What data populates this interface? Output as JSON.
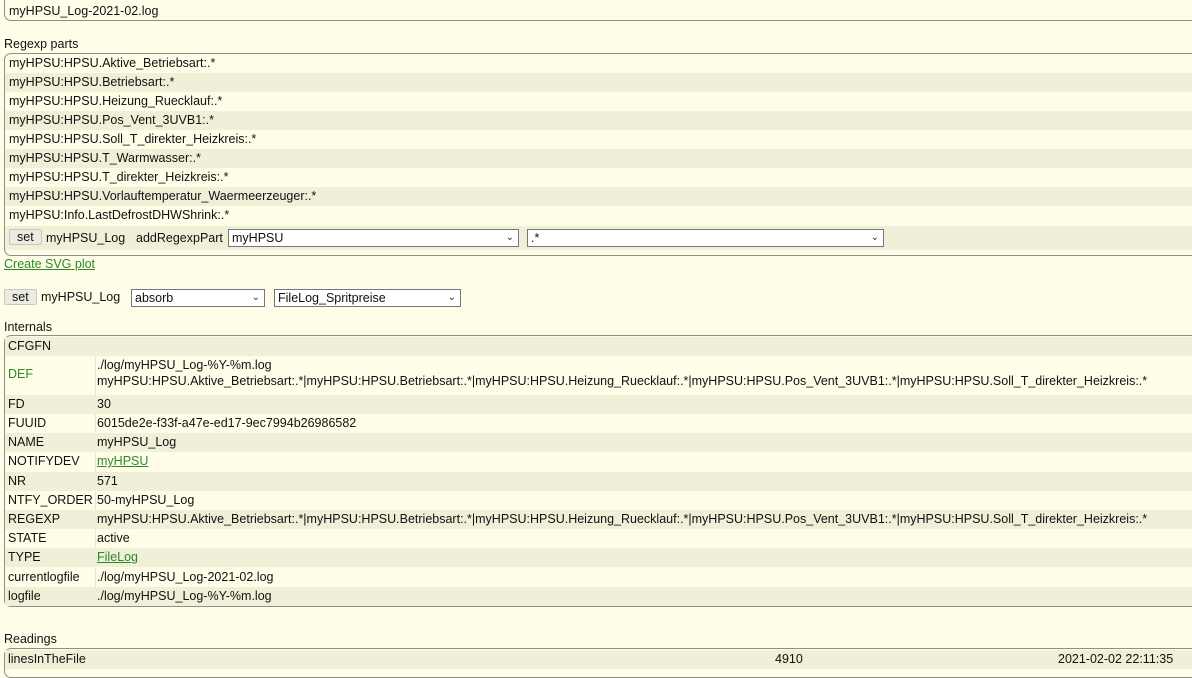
{
  "file_title": "myHPSU_Log-2021-02.log",
  "regexp_section": {
    "title": "Regexp parts",
    "parts": [
      "myHPSU:HPSU.Aktive_Betriebsart:.*",
      "myHPSU:HPSU.Betriebsart:.*",
      "myHPSU:HPSU.Heizung_Ruecklauf:.*",
      "myHPSU:HPSU.Pos_Vent_3UVB1:.*",
      "myHPSU:HPSU.Soll_T_direkter_Heizkreis:.*",
      "myHPSU:HPSU.T_Warmwasser:.*",
      "myHPSU:HPSU.T_direkter_Heizkreis:.*",
      "myHPSU:HPSU.Vorlauftemperatur_Waermeerzeuger:.*",
      "myHPSU:Info.LastDefrostDHWShrink:.*"
    ],
    "set_label": "set",
    "device": "myHPSU_Log",
    "command": "addRegexpPart",
    "device_select": "myHPSU",
    "regexp_select": ".*"
  },
  "svg_link": "Create SVG plot",
  "set_row": {
    "set_label": "set",
    "device": "myHPSU_Log",
    "select1": "absorb",
    "select2": "FileLog_Spritpreise"
  },
  "internals": {
    "title": "Internals",
    "rows": [
      {
        "key": "CFGFN",
        "value": ""
      },
      {
        "key": "DEF",
        "value": "./log/myHPSU_Log-%Y-%m.log",
        "value2": "myHPSU:HPSU.Aktive_Betriebsart:.*|myHPSU:HPSU.Betriebsart:.*|myHPSU:HPSU.Heizung_Ruecklauf:.*|myHPSU:HPSU.Pos_Vent_3UVB1:.*|myHPSU:HPSU.Soll_T_direkter_Heizkreis:.*"
      },
      {
        "key": "FD",
        "value": "30"
      },
      {
        "key": "FUUID",
        "value": "6015de2e-f33f-a47e-ed17-9ec7994b26986582"
      },
      {
        "key": "NAME",
        "value": "myHPSU_Log"
      },
      {
        "key": "NOTIFYDEV",
        "value": "myHPSU"
      },
      {
        "key": "NR",
        "value": "571"
      },
      {
        "key": "NTFY_ORDER",
        "value": "50-myHPSU_Log"
      },
      {
        "key": "REGEXP",
        "value": "myHPSU:HPSU.Aktive_Betriebsart:.*|myHPSU:HPSU.Betriebsart:.*|myHPSU:HPSU.Heizung_Ruecklauf:.*|myHPSU:HPSU.Pos_Vent_3UVB1:.*|myHPSU:HPSU.Soll_T_direkter_Heizkreis:.*"
      },
      {
        "key": "STATE",
        "value": "active"
      },
      {
        "key": "TYPE",
        "value": "FileLog"
      },
      {
        "key": "currentlogfile",
        "value": "./log/myHPSU_Log-2021-02.log"
      },
      {
        "key": "logfile",
        "value": "./log/myHPSU_Log-%Y-%m.log"
      }
    ]
  },
  "readings": {
    "title": "Readings",
    "rows": [
      {
        "name": "linesInTheFile",
        "value": "4910",
        "time": "2021-02-02 22:11:35"
      }
    ]
  }
}
